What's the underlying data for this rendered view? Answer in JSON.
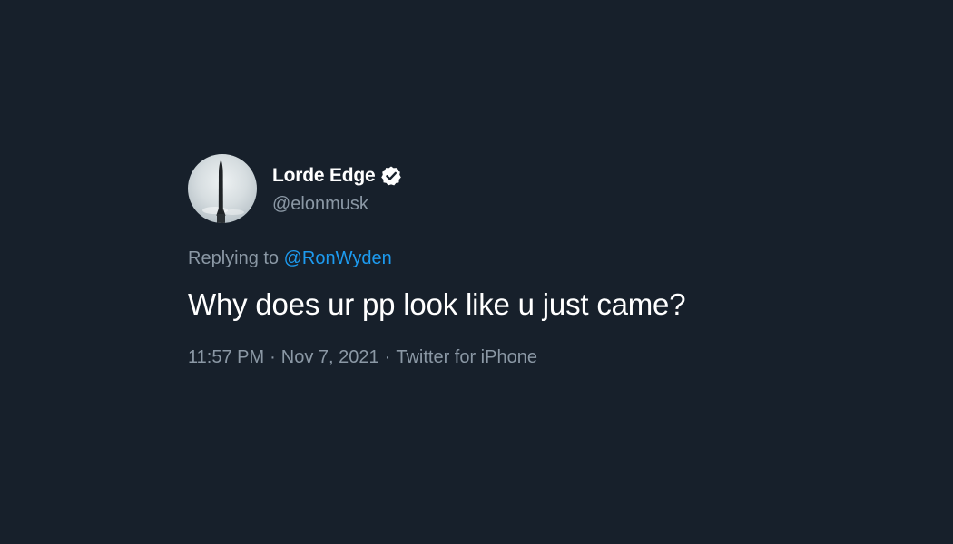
{
  "tweet": {
    "author": {
      "display_name": "Lorde Edge",
      "handle": "@elonmusk",
      "verified": true,
      "avatar_icon": "starship-avatar-icon",
      "verified_icon": "verified-badge-icon"
    },
    "reply": {
      "prefix": "Replying to",
      "mention": "@RonWyden"
    },
    "text": "Why does ur pp look like u just came?",
    "meta": {
      "time": "11:57 PM",
      "separator": "·",
      "date": "Nov 7, 2021",
      "source": "Twitter for iPhone"
    }
  },
  "colors": {
    "background": "#17202b",
    "primary_text": "#ffffff",
    "secondary_text": "#8b98a5",
    "link": "#1d9bf0"
  }
}
